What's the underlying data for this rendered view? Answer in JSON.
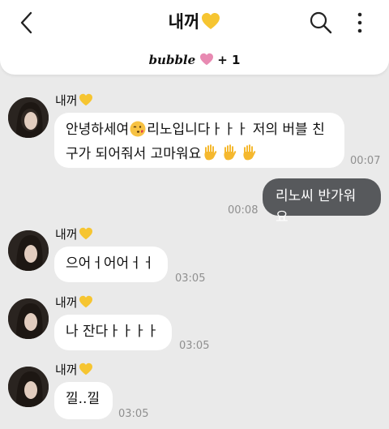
{
  "header": {
    "title": "내꺼",
    "sub_brand": "bubble",
    "sub_count": "+ 1"
  },
  "colors": {
    "background": "#eaeaea",
    "incoming_bubble": "#ffffff",
    "outgoing_bubble": "#57595c",
    "heart_yellow": "#f6c531",
    "heart_pink": "#e88ab2",
    "timestamp": "#8f8f8f"
  },
  "icons": [
    "back-arrow-icon",
    "search-icon",
    "more-vertical-icon",
    "yellow-heart-icon",
    "pink-heart-icon",
    "kiss-face-emoji",
    "raised-hand-emoji"
  ],
  "messages": [
    {
      "sender": "내꺼",
      "text_line1": "안녕하세여",
      "text_line1b": "리노입니다ㅏㅏㅏ 저의 버블 친",
      "text_line2": "구가 되어줘서 고마워요",
      "time": "00:07"
    },
    {
      "sender": "me",
      "text": "리노씨 반가워요",
      "time": "00:08"
    },
    {
      "sender": "내꺼",
      "text": "으어ㅓ어어ㅓㅓ",
      "time": "03:05"
    },
    {
      "sender": "내꺼",
      "text": "나 잔다ㅏㅏㅏㅏ",
      "time": "03:05"
    },
    {
      "sender": "내꺼",
      "text": "낄..낄",
      "time": "03:05"
    }
  ]
}
